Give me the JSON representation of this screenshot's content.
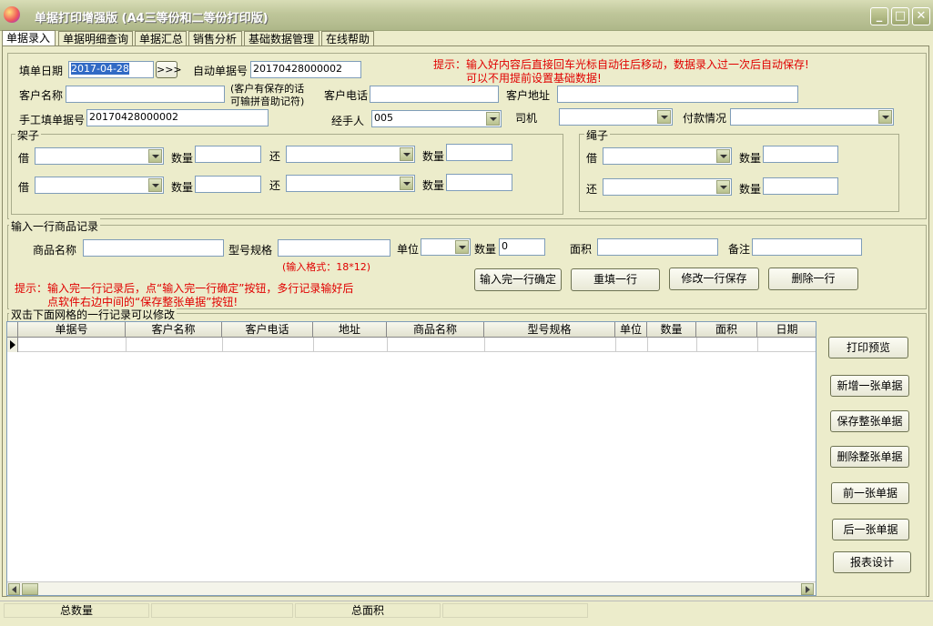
{
  "window": {
    "title": "单据打印增强版 (A4三等份和二等份打印版)",
    "min": "_",
    "max": "□",
    "close": "✕"
  },
  "tabs": [
    "单据录入",
    "单据明细查询",
    "单据汇总",
    "销售分析",
    "基础数据管理",
    "在线帮助"
  ],
  "header": {
    "date_label": "填单日期",
    "date_value": "2017-04-28",
    "date_btn": ">>>",
    "auto_no_label": "自动单据号",
    "auto_no_value": "20170428000002",
    "hint_line1": "提示：输入好内容后直接回车光标自动往后移动，数据录入过一次后自动保存!",
    "hint_line2": "可以不用提前设置基础数据!",
    "customer_label": "客户名称",
    "customer_note1": "(客户有保存的话",
    "customer_note2": "可输拼音助记符)",
    "phone_label": "客户电话",
    "address_label": "客户地址",
    "manual_no_label": "手工填单据号",
    "manual_no_value": "20170428000002",
    "handler_label": "经手人",
    "handler_value": "005",
    "driver_label": "司机",
    "payment_label": "付款情况"
  },
  "rack": {
    "title": "架子",
    "borrow": "借",
    "qty": "数量",
    "return": "还"
  },
  "rope": {
    "title": "绳子",
    "borrow": "借",
    "qty": "数量",
    "return": "还"
  },
  "item_entry": {
    "title": "输入一行商品记录",
    "product_label": "商品名称",
    "spec_label": "型号规格",
    "spec_hint": "(输入格式：18*12)",
    "unit_label": "单位",
    "qty_label": "数量",
    "qty_value": "0",
    "area_label": "面积",
    "note_label": "备注",
    "btn_confirm": "输入完一行确定",
    "btn_refill": "重填一行",
    "btn_modify": "修改一行保存",
    "btn_delete": "删除一行",
    "hint_line1": "提示：输入完一行记录后，点“输入完一行确定”按钮，多行记录输好后",
    "hint_line2": "点软件右边中间的“保存整张单据”按钮!"
  },
  "grid": {
    "title": "双击下面网格的一行记录可以修改",
    "columns": [
      "单据号",
      "客户名称",
      "客户电话",
      "地址",
      "商品名称",
      "型号规格",
      "单位",
      "数量",
      "面积",
      "日期"
    ]
  },
  "side_buttons": {
    "preview": "打印预览",
    "new": "新增一张单据",
    "save": "保存整张单据",
    "delete": "删除整张单据",
    "prev": "前一张单据",
    "next": "后一张单据",
    "report": "报表设计"
  },
  "status": {
    "total_qty": "总数量",
    "total_area": "总面积"
  }
}
